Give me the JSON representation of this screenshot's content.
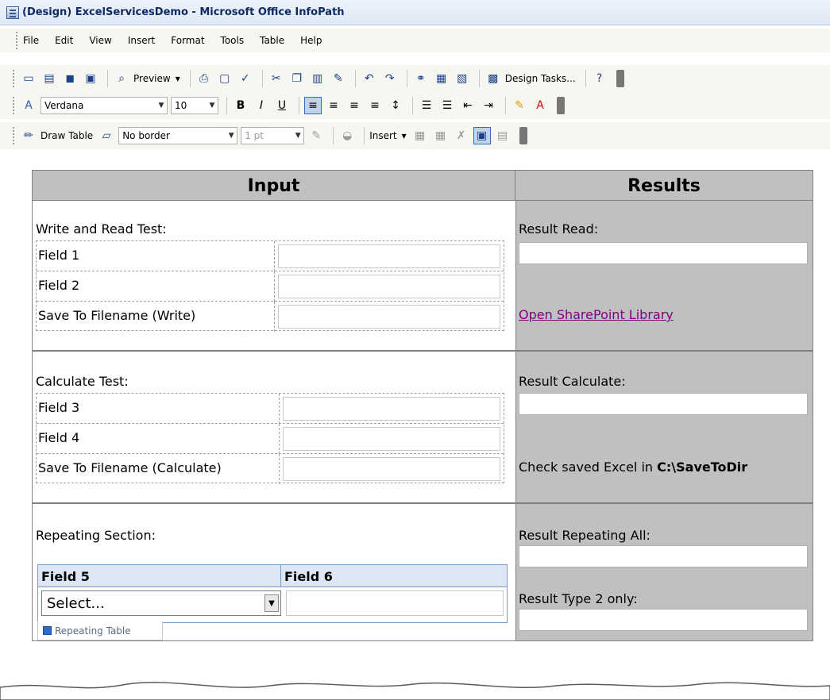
{
  "window": {
    "title": "(Design) ExcelServicesDemo - Microsoft Office InfoPath"
  },
  "menu": [
    "File",
    "Edit",
    "View",
    "Insert",
    "Format",
    "Tools",
    "Table",
    "Help"
  ],
  "toolbar1": {
    "preview_label": "Preview",
    "design_tasks_label": "Design Tasks..."
  },
  "toolbar2": {
    "font_name": "Verdana",
    "font_size": "10"
  },
  "toolbar3": {
    "draw_table_label": "Draw Table",
    "border_label": "No border",
    "border_width": "1 pt",
    "insert_label": "Insert"
  },
  "form": {
    "header_input": "Input",
    "header_results": "Results",
    "section1": {
      "title": "Write and Read Test:",
      "fields": [
        "Field 1",
        "Field 2",
        "Save To Filename (Write)"
      ],
      "result_label": "Result Read:",
      "link_text": "Open SharePoint Library"
    },
    "section2": {
      "title": "Calculate Test:",
      "fields": [
        "Field 3",
        "Field 4",
        "Save To Filename (Calculate)"
      ],
      "result_label": "Result Calculate:",
      "check_text": "Check saved Excel in ",
      "check_path": "C:\\SaveToDir"
    },
    "section3": {
      "title": "Repeating Section:",
      "col1": "Field 5",
      "col2": "Field 6",
      "select_value": "Select...",
      "tab_label": "Repeating Table",
      "result_all": "Result Repeating All:",
      "result_type2": "Result Type 2 only:"
    }
  }
}
